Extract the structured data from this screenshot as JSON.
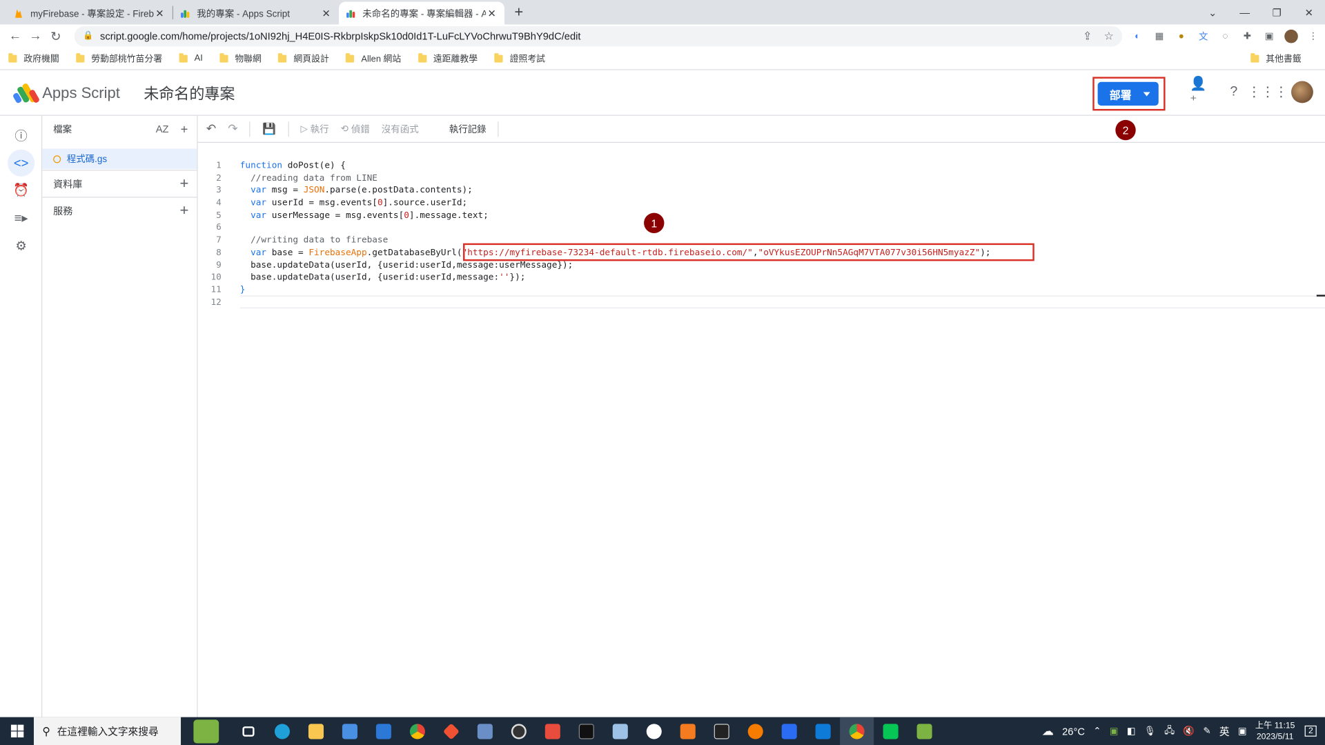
{
  "browser": {
    "tabs": [
      {
        "label": "myFirebase - 專案設定 - Fireba",
        "favicon_color": "#ffa000",
        "active": false
      },
      {
        "label": "我的專案 - Apps Script",
        "favicon_color": "#4285f4",
        "active": false
      },
      {
        "label": "未命名的專案 - 專案編輯器 - App",
        "favicon_color": "#4285f4",
        "active": true
      }
    ],
    "url": "script.google.com/home/projects/1oNI92hj_H4E0IS-RkbrpIskpSk10d0Id1T-LuFcLYVoChrwuT9BhY9dC/edit",
    "bookmarks": [
      "政府機關",
      "勞動部桃竹苗分署",
      "AI",
      "物聯網",
      "網頁設計",
      "Allen 網站",
      "遠距離教學",
      "證照考試"
    ],
    "other_bookmarks": "其他書籤"
  },
  "app": {
    "name": "Apps Script",
    "project_title": "未命名的專案",
    "deploy_label": "部署"
  },
  "files_panel": {
    "title": "檔案",
    "sort_label": "AZ",
    "file_name": "程式碼.gs",
    "library_label": "資料庫",
    "services_label": "服務"
  },
  "editor_toolbar": {
    "run": "執行",
    "debug": "偵錯",
    "no_function": "沒有函式",
    "execution_log": "執行記錄"
  },
  "code_lines": [
    "function doPost(e) {",
    "  //reading data from LINE",
    "  var msg = JSON.parse(e.postData.contents);",
    "  var userId = msg.events[0].source.userId;",
    "  var userMessage = msg.events[0].message.text;",
    "",
    "  //writing data to firebase",
    "  var base = FirebaseApp.getDatabaseByUrl(\"https://myfirebase-73234-default-rtdb.firebaseio.com/\",\"oVYkusEZOUPrNn5AGqM7VTA077v30i56HN5myazZ\");",
    "  base.updateData(userId, {userid:userId,message:userMessage});",
    "  base.updateData(userId, {userid:userId,message:''});",
    "}",
    ""
  ],
  "annotations": {
    "badge1": "1",
    "badge2": "2"
  },
  "taskbar": {
    "search_placeholder": "在這裡輸入文字來搜尋",
    "weather": "26°C",
    "ime": "英",
    "time": "上午 11:15",
    "date": "2023/5/11",
    "notifications": "2"
  },
  "colors": {
    "accent": "#1a73e8",
    "annotation_red": "#d93025",
    "badge": "#8b0000"
  }
}
